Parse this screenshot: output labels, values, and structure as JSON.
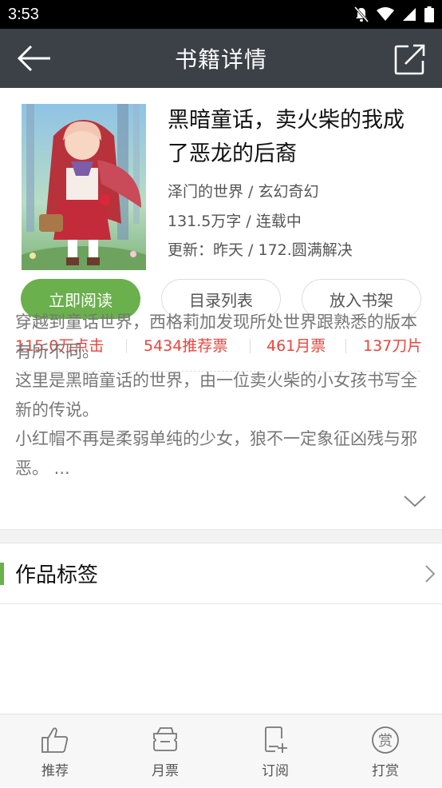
{
  "status_bar": {
    "time": "3:53"
  },
  "app_bar": {
    "title": "书籍详情"
  },
  "book": {
    "title": "黑暗童话，卖火柴的我成了恶龙的后裔",
    "author_genre": "泽门的世界 / 玄幻奇幻",
    "words_status": "131.5万字 / 连载中",
    "update": "更新：昨天 / 172.圆满解决"
  },
  "actions": {
    "read": "立即阅读",
    "catalog": "目录列表",
    "shelf": "放入书架"
  },
  "stats": {
    "clicks": "115.0万点击",
    "recommend": "5434推荐票",
    "monthly": "461月票",
    "blades": "137刀片"
  },
  "synopsis": [
    "穿越到童话世界，西格莉加发现所处世界跟熟悉的版本有所不同。",
    "这里是黑暗童话的世界，由一位卖火柴的小女孩书写全新的传说。",
    "小红帽不再是柔弱单纯的少女，狼不一定象征凶残与邪恶。 ..."
  ],
  "tags": {
    "label": "作品标签"
  },
  "bottom_nav": [
    {
      "label": "推荐",
      "icon": "thumbs-up-icon"
    },
    {
      "label": "月票",
      "icon": "ticket-icon"
    },
    {
      "label": "订阅",
      "icon": "subscribe-icon"
    },
    {
      "label": "打赏",
      "icon": "reward-icon"
    }
  ],
  "colors": {
    "accent": "#6ab04c",
    "stat_red": "#e8453c",
    "app_bar": "#3c4047"
  }
}
